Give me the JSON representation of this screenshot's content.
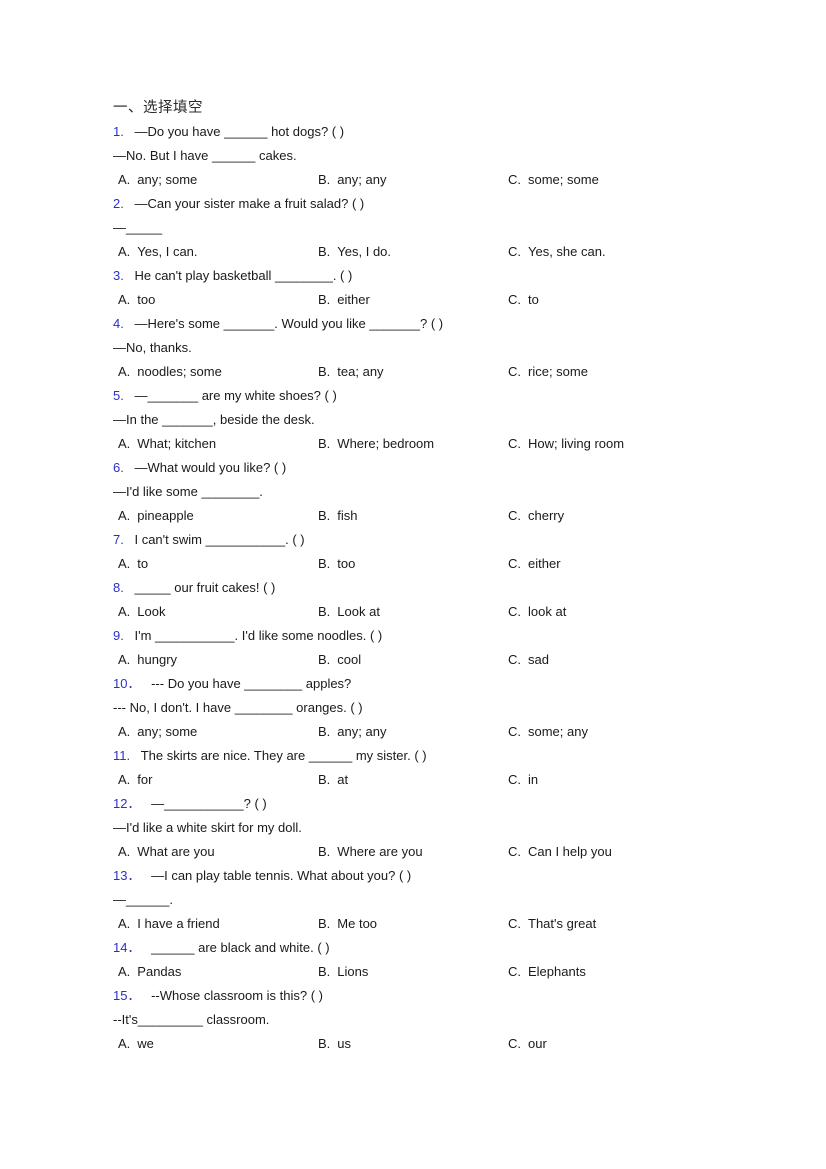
{
  "document": {
    "section_heading": "一、选择填空",
    "option_letters": {
      "a": "A.",
      "b": "B.",
      "c": "C."
    },
    "questions": [
      {
        "number": "1.",
        "stem": "—Do you have ______ hot dogs? (  )",
        "continuation": "—No. But I have ______ cakes.",
        "options": {
          "a": "any; some",
          "b": "any; any",
          "c": "some; some"
        }
      },
      {
        "number": "2.",
        "stem": "—Can your sister make a fruit salad? (  )",
        "continuation": "—_____",
        "options": {
          "a": "Yes, I can.",
          "b": "Yes, I do.",
          "c": "Yes, she can."
        }
      },
      {
        "number": "3.",
        "stem": "He can't play basketball ________. (   )",
        "continuation": "",
        "options": {
          "a": "too",
          "b": "either",
          "c": "to"
        }
      },
      {
        "number": "4.",
        "stem": "—Here's some _______. Would you like _______? (   )",
        "continuation": "—No, thanks.",
        "options": {
          "a": "noodles; some",
          "b": "tea; any",
          "c": "rice; some"
        }
      },
      {
        "number": "5.",
        "stem": "—_______ are my white shoes? (   )",
        "continuation": "—In the _______, beside the desk.",
        "options": {
          "a": "What; kitchen",
          "b": "Where; bedroom",
          "c": "How; living room"
        }
      },
      {
        "number": "6.",
        "stem": "—What would you like? (  )",
        "continuation": "—I'd like some ________.",
        "options": {
          "a": "pineapple",
          "b": "fish",
          "c": "cherry"
        }
      },
      {
        "number": "7.",
        "stem": "I can't swim ___________. (  )",
        "continuation": "",
        "options": {
          "a": "to",
          "b": "too",
          "c": "either"
        }
      },
      {
        "number": "8.",
        "stem": "_____ our fruit cakes! (  )",
        "continuation": "",
        "options": {
          "a": "Look",
          "b": "Look at",
          "c": "look at"
        }
      },
      {
        "number": "9.",
        "stem": "I'm ___________. I'd like some noodles. (  )",
        "continuation": "",
        "options": {
          "a": "hungry",
          "b": "cool",
          "c": "sad"
        }
      },
      {
        "number": "10．",
        "stem": "--- Do you have ________ apples?",
        "continuation": "--- No, I don't. I have ________ oranges. (  )",
        "options": {
          "a": "any; some",
          "b": "any; any",
          "c": "some; any"
        }
      },
      {
        "number": "11.",
        "stem": "The skirts are nice. They are ______ my sister. (  )",
        "continuation": "",
        "options": {
          "a": "for",
          "b": "at",
          "c": "in"
        }
      },
      {
        "number": "12．",
        "stem": "—___________? (  )",
        "continuation": "—I'd like a white skirt for my doll.",
        "options": {
          "a": "What are you",
          "b": "Where are you",
          "c": "Can I help you"
        }
      },
      {
        "number": "13．",
        "stem": "—I can play table tennis. What about you? (   )",
        "continuation": "—______.",
        "options": {
          "a": "I have a friend",
          "b": "Me too",
          "c": "That's great"
        }
      },
      {
        "number": "14．",
        "stem": "______ are black and white. (  )",
        "continuation": "",
        "options": {
          "a": "Pandas",
          "b": "Lions",
          "c": "Elephants"
        }
      },
      {
        "number": "15．",
        "stem": "--Whose classroom is this? (   )",
        "continuation": "--It's_________ classroom.",
        "options": {
          "a": "we",
          "b": "us",
          "c": "our"
        }
      }
    ]
  },
  "colors": {
    "question_number": "#2b31c8",
    "body_text": "#1a1a1a",
    "page_background": "#ffffff"
  }
}
